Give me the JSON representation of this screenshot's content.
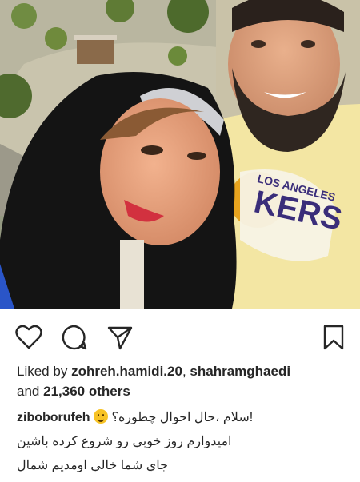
{
  "post": {
    "likes_prefix": "Liked by",
    "liker_1": "zohreh.hamidi.20",
    "liker_sep": ",",
    "liker_2": "shahramghaedi",
    "and_label": "and",
    "others_count": "21,360 others",
    "caption_user": "ziboborufeh",
    "caption_line_1": "!سلام ،حال احوال چطوره؟",
    "caption_line_2": "اميدوارم روز خوبي رو شروع كرده باشين",
    "caption_line_3": "جاي شما خالي اومديم شمال",
    "shirt_text_1": "LOS ANGELES",
    "shirt_text_2": "KERS"
  },
  "icons": {
    "like": "heart-icon",
    "comment": "comment-icon",
    "share": "send-icon",
    "save": "bookmark-icon",
    "emoji": "smiling-face-emoji"
  },
  "colors": {
    "text": "#262626",
    "hijab": "#141414",
    "jersey": "#f3e6a3",
    "lakers_purple": "#3a2d7a",
    "lakers_gold": "#e8a41e"
  }
}
